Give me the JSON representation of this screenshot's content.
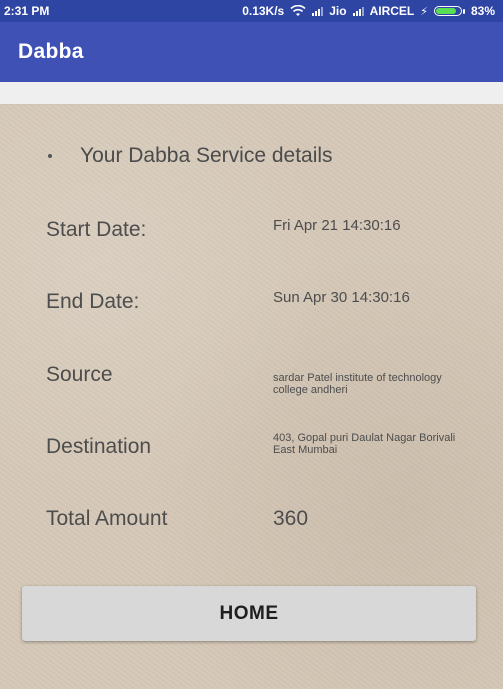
{
  "status_bar": {
    "time": "2:31 PM",
    "speed": "0.13K/s",
    "carrier1": "Jio",
    "carrier2": "AIRCEL",
    "battery": "83%",
    "battery_level": 0.83
  },
  "app_bar": {
    "title": "Dabba"
  },
  "details": {
    "heading": "Your Dabba Service details",
    "start_label": "Start Date:",
    "start_value": "Fri Apr 21 14:30:16",
    "end_label": "End Date:",
    "end_value": "Sun Apr 30 14:30:16",
    "source_label": "Source",
    "source_value": "sardar Patel institute of technology college andheri",
    "destination_label": "Destination",
    "destination_value": "403, Gopal puri Daulat Nagar Borivali East Mumbai",
    "total_label": "Total Amount",
    "total_value": "360"
  },
  "home_button": {
    "label": "HOME"
  },
  "colors": {
    "status_bar": "#2f45a4",
    "app_bar": "#3f51b5",
    "battery_fill": "#59e052"
  },
  "icons": [
    "wifi-icon",
    "signal-icon",
    "battery-icon",
    "charging-icon"
  ]
}
